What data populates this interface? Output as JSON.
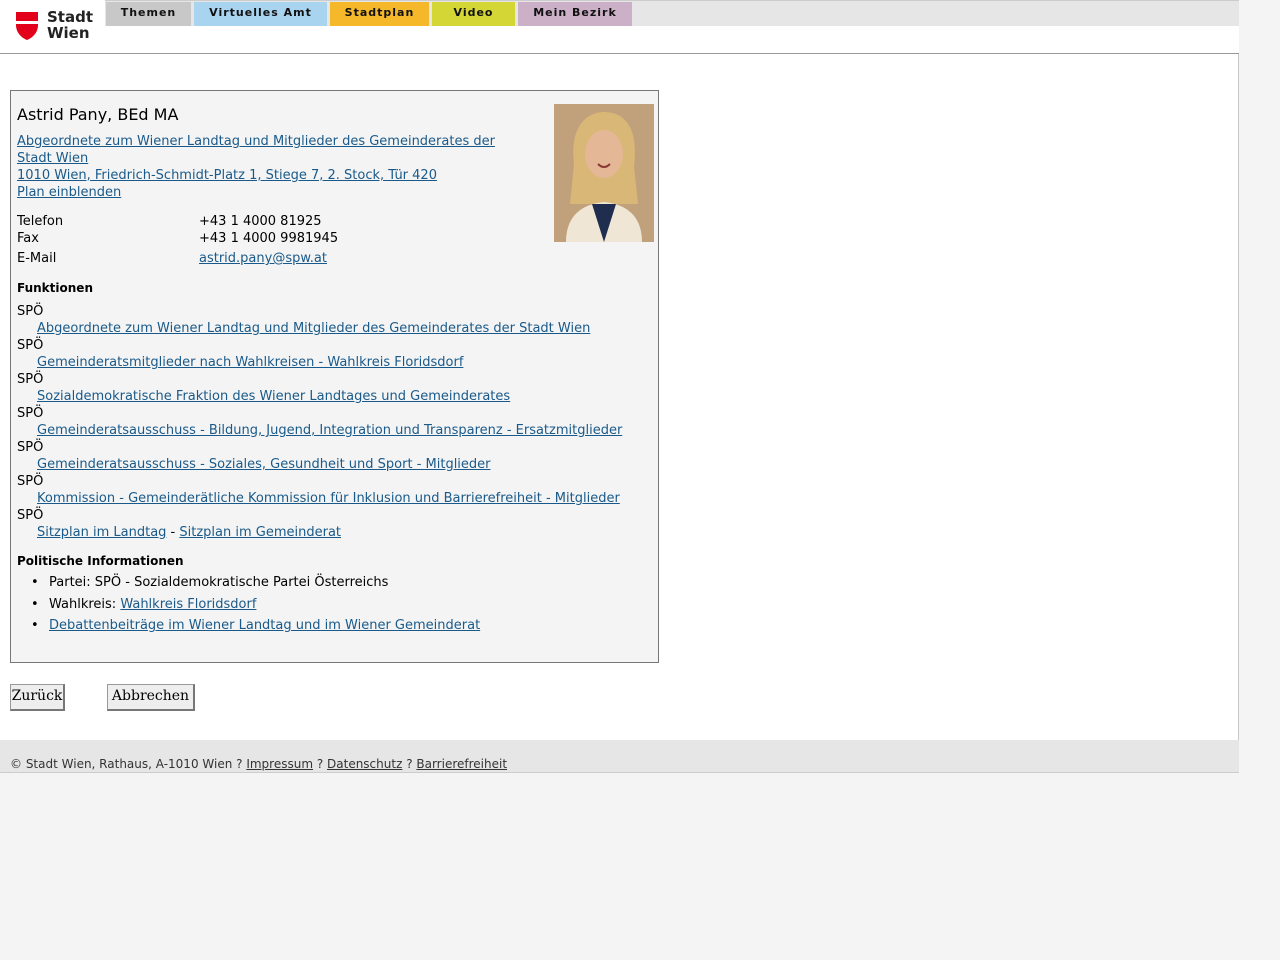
{
  "header": {
    "logo_line1": "Stadt",
    "logo_line2": "Wien",
    "tabs": [
      {
        "label": "Themen",
        "color": "#c8c8c8"
      },
      {
        "label": "Virtuelles Amt",
        "color": "#a8d4f0"
      },
      {
        "label": "Stadtplan",
        "color": "#f5b82a"
      },
      {
        "label": "Video",
        "color": "#d3d635"
      },
      {
        "label": "Mein Bezirk",
        "color": "#cbb0c8"
      }
    ]
  },
  "person": {
    "name": "Astrid Pany, BEd MA",
    "org_line1": "Abgeordnete zum Wiener Landtag und Mitglieder des Gemeinderates der",
    "org_line2": "Stadt Wien ",
    "address": "1010 Wien, Friedrich-Schmidt-Platz 1, Stiege 7, 2. Stock, Tür 420",
    "plan_link": "Plan einblenden"
  },
  "contact": {
    "phone_label": "Telefon",
    "phone": "+43 1 4000 81925",
    "fax_label": "Fax",
    "fax": "+43 1 4000 9981945",
    "email_label": "E-Mail",
    "email": "astrid.pany@spw.at"
  },
  "functions": {
    "heading": "Funktionen",
    "items": [
      {
        "party": "SPÖ",
        "link": "Abgeordnete zum Wiener Landtag und Mitglieder des Gemeinderates der Stadt Wien"
      },
      {
        "party": "SPÖ",
        "link": "Gemeinderatsmitglieder nach Wahlkreisen - Wahlkreis Floridsdorf"
      },
      {
        "party": "SPÖ",
        "link": "Sozialdemokratische Fraktion des Wiener Landtages und Gemeinderates"
      },
      {
        "party": "SPÖ",
        "link": "Gemeinderatsausschuss - Bildung, Jugend, Integration und Transparenz - Ersatzmitglieder"
      },
      {
        "party": "SPÖ",
        "link": "Gemeinderatsausschuss - Soziales, Gesundheit und Sport - Mitglieder"
      },
      {
        "party": "SPÖ",
        "link": "Kommission - Gemeinderätliche Kommission für Inklusion und Barrierefreiheit - Mitglieder"
      }
    ],
    "last_party": "SPÖ",
    "seat_landtag": "Sitzplan im Landtag",
    "seat_sep": " - ",
    "seat_gemeinderat": "Sitzplan im Gemeinderat"
  },
  "political": {
    "heading": "Politische Informationen",
    "party_text": "Partei: SPÖ - Sozialdemokratische Partei Österreichs",
    "district_label": "Wahlkreis: ",
    "district_link": "Wahlkreis Floridsdorf",
    "debates_link": "Debattenbeiträge im Wiener Landtag und im Wiener Gemeinderat"
  },
  "buttons": {
    "back": "Zurück",
    "cancel": "Abbrechen"
  },
  "footer": {
    "copyright": "© Stadt Wien, Rathaus, A-1010 Wien ? ",
    "impressum": "Impressum",
    "sep1": " ? ",
    "datenschutz": "Datenschutz",
    "sep2": " ? ",
    "barrierefreiheit": "Barrierefreiheit"
  },
  "colors": {
    "link": "#1a5a8a",
    "wien_red": "#e2001a"
  }
}
